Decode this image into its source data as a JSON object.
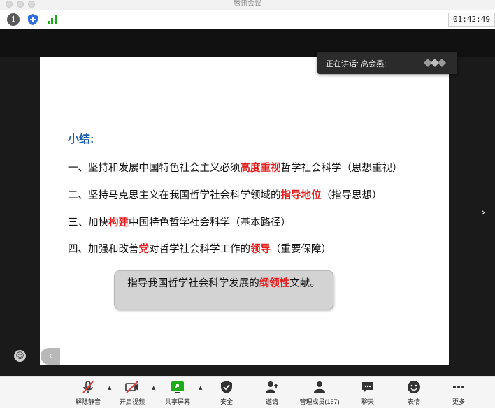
{
  "window": {
    "title": "腾讯会议"
  },
  "topbar": {
    "icons": [
      "info-icon",
      "shield-icon",
      "signal-icon"
    ],
    "timer": "01:42:49"
  },
  "speaker": {
    "label": "正在讲话: 高会燕;"
  },
  "slide": {
    "title": "小结:",
    "points": [
      {
        "pre": "一、坚持和发展中国特色社会主义必须",
        "em": "高度重视",
        "post": "哲学社会科学（思想重视）"
      },
      {
        "pre": "二、坚持马克思主义在我国哲学社会科学领域的",
        "em": "指导地位",
        "post": "（指导思想）"
      },
      {
        "pre": "三、加快",
        "em": "构建",
        "post": "中国特色哲学社会科学（基本路径）"
      },
      {
        "pre": "四、加强和改善",
        "em": "党",
        "mid": "对哲学社会科学工作的",
        "em2": "领导",
        "post": "（重要保障）"
      }
    ],
    "callout": {
      "pre": "指导我国哲学社会科学发展的",
      "em": "纲领性",
      "post": "文献。"
    }
  },
  "toolbar": {
    "unmute": "解除静音",
    "video": "开启视频",
    "share": "共享屏幕",
    "security": "安全",
    "invite": "邀请",
    "members": "管理成员(157)",
    "chat": "聊天",
    "reactions": "表情",
    "more": "更多"
  },
  "colors": {
    "accent_blue": "#1f5fa8",
    "emphasis_red": "#e02020",
    "share_green": "#1aad19",
    "video_red": "#e23b3b"
  }
}
